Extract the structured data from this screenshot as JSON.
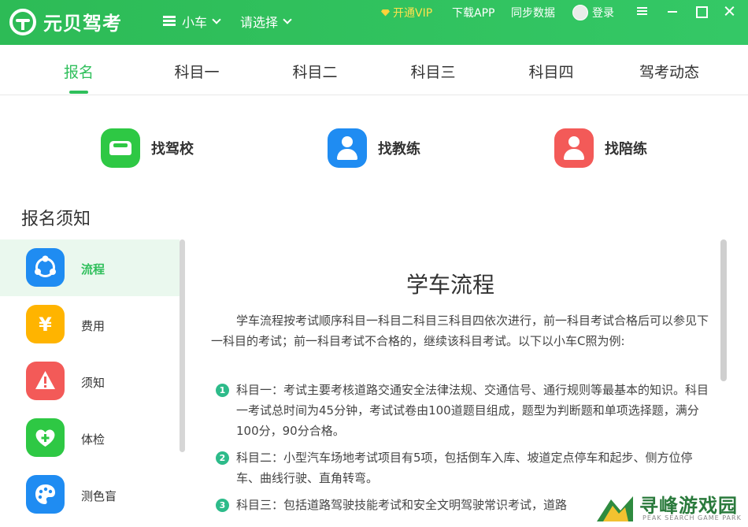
{
  "app": {
    "name": "元贝驾考"
  },
  "header": {
    "vehicle_select": "小车",
    "region_select": "请选择",
    "vip_label": "开通VIP",
    "download_label": "下载APP",
    "sync_label": "同步数据",
    "login_label": "登录"
  },
  "tabs": [
    {
      "label": "报名",
      "active": true
    },
    {
      "label": "科目一"
    },
    {
      "label": "科目二"
    },
    {
      "label": "科目三"
    },
    {
      "label": "科目四"
    },
    {
      "label": "驾考动态"
    }
  ],
  "quick_actions": [
    {
      "label": "找驾校",
      "icon": "car-icon",
      "color": "#2ec844"
    },
    {
      "label": "找教练",
      "icon": "coach-icon",
      "color": "#1f8cf2"
    },
    {
      "label": "找陪练",
      "icon": "trainer-icon",
      "color": "#f35a58"
    }
  ],
  "section_title": "报名须知",
  "sidebar": {
    "items": [
      {
        "label": "流程",
        "icon": "share-nodes-icon",
        "color": "#1f8cf2",
        "active": true
      },
      {
        "label": "费用",
        "icon": "yen-icon",
        "color": "#ffb400"
      },
      {
        "label": "须知",
        "icon": "warning-icon",
        "color": "#f35a58"
      },
      {
        "label": "体检",
        "icon": "heart-plus-icon",
        "color": "#2ec844"
      },
      {
        "label": "测色盲",
        "icon": "palette-icon",
        "color": "#1f8cf2"
      }
    ]
  },
  "content": {
    "title": "学车流程",
    "intro": "学车流程按考试顺序科目一科目二科目三科目四依次进行，前一科目考试合格后可以参见下一科目的考试；前一科目考试不合格的，继续该科目考试。以下以小车C照为例:",
    "steps": [
      {
        "num": "1",
        "text": "科目一：考试主要考核道路交通安全法律法规、交通信号、通行规则等最基本的知识。科目一考试总时间为45分钟，考试试卷由100道题目组成，题型为判断题和单项选择题，满分100分，90分合格。"
      },
      {
        "num": "2",
        "text": "科目二：小型汽车场地考试项目有5项，包括倒车入库、坡道定点停车和起步、侧方位停车、曲线行驶、直角转弯。"
      },
      {
        "num": "3",
        "text": "科目三：包括道路驾驶技能考试和安全文明驾驶常识考试，道路"
      }
    ]
  },
  "watermark": {
    "text": "寻峰游戏园",
    "sub": "PEAK SEARCH GAME PARK"
  }
}
